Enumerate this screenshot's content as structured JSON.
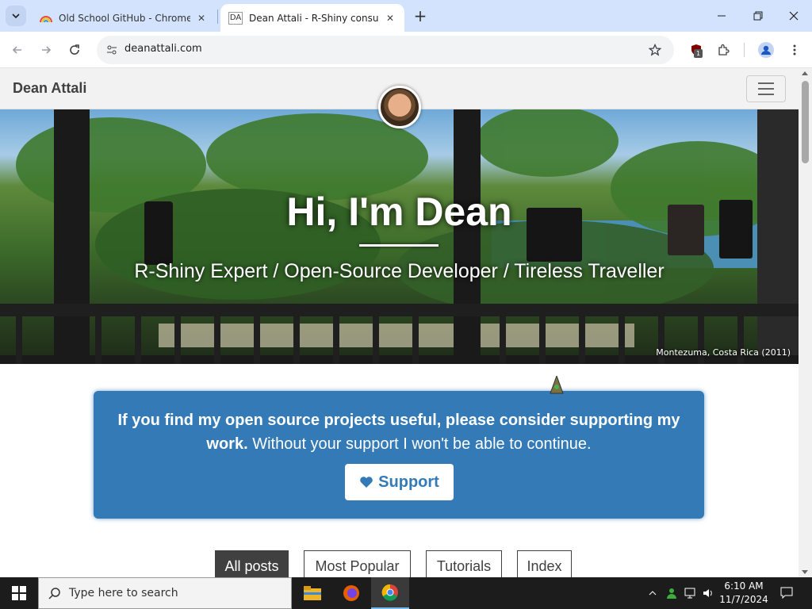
{
  "browser": {
    "tabs": [
      {
        "title": "Old School GitHub - Chrome W",
        "active": false
      },
      {
        "title": "Dean Attali - R-Shiny consultan",
        "active": true,
        "favicon_text": "DA"
      }
    ],
    "url": "deanattali.com",
    "extension_badge": "1"
  },
  "site": {
    "brand": "Dean Attali",
    "hero_title": "Hi, I'm Dean",
    "hero_subtitle": "R-Shiny Expert / Open-Source Developer / Tireless Traveller",
    "hero_caption": "Montezuma, Costa Rica (2011)",
    "support": {
      "bold_text": "If you find my open source projects useful, please consider supporting my work.",
      "text": " Without your support I won't be able to continue.",
      "button_label": "Support"
    },
    "post_tabs": [
      {
        "label": "All posts",
        "selected": true
      },
      {
        "label": "Most Popular",
        "selected": false
      },
      {
        "label": "Tutorials",
        "selected": false
      },
      {
        "label": "Index",
        "selected": false
      }
    ]
  },
  "taskbar": {
    "search_placeholder": "Type here to search",
    "time": "6:10 AM",
    "date": "11/7/2024"
  },
  "colors": {
    "tabstrip": "#d3e3fd",
    "support_blue": "#337ab7",
    "nav_text": "#404040"
  }
}
